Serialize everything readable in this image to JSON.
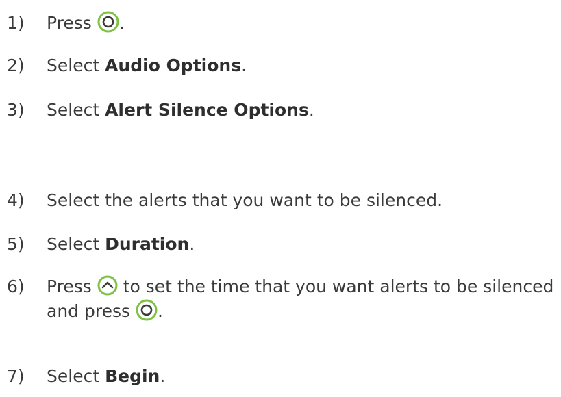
{
  "accent_color": "#7dc242",
  "steps": [
    {
      "num": "1)",
      "pre": "Press",
      "icon": "ok-button-icon",
      "post": "."
    },
    {
      "num": "2)",
      "pre": "Select ",
      "bold": "Audio Options",
      "post": "."
    },
    {
      "num": "3)",
      "pre": "Select ",
      "bold": "Alert Silence Options",
      "post": "."
    },
    {
      "num": "4)",
      "pre": "Select the alerts that you want to be silenced."
    },
    {
      "num": "5)",
      "pre": "Select ",
      "bold": "Duration",
      "post": "."
    },
    {
      "num": "6)",
      "pre": "Press",
      "icon": "up-arrow-button-icon",
      "post": "to set the time that you want alerts to be silenced",
      "line2_pre": "and press",
      "line2_icon": "ok-button-icon",
      "line2_post": "."
    },
    {
      "num": "7)",
      "pre": "Select ",
      "bold": "Begin",
      "post": "."
    }
  ]
}
